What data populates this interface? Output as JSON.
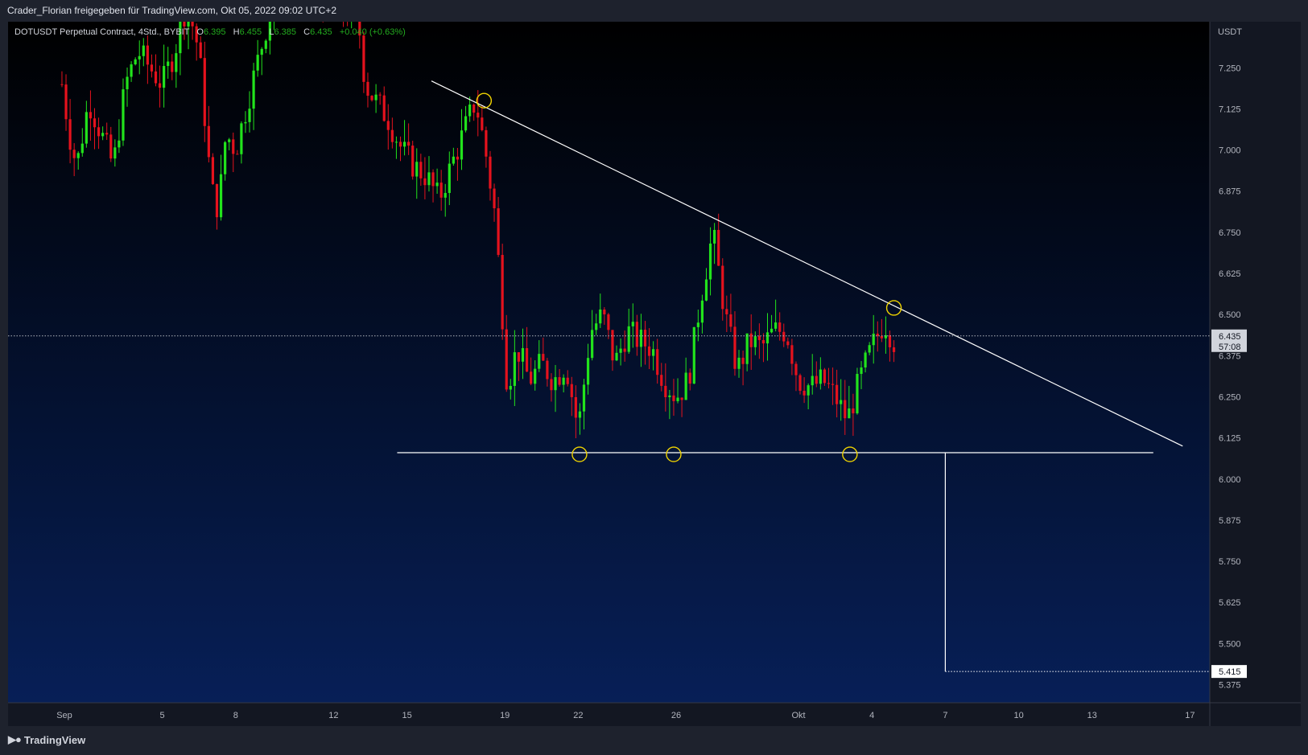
{
  "header": {
    "share_text": "Crader_Florian freigegeben für TradingView.com, Okt 05, 2022 09:02 UTC+2"
  },
  "legend": {
    "symbol": "DOTUSDT Perpetual Contract, 4Std., BYBIT",
    "open_label": "O",
    "open": "6.395",
    "high_label": "H",
    "high": "6.455",
    "low_label": "L",
    "low": "6.385",
    "close_label": "C",
    "close": "6.435",
    "change": "+0.040 (+0.63%)"
  },
  "footer": {
    "brand": "TradingView",
    "logo_icon": "tradingview-logo-icon"
  },
  "colors": {
    "up": "#22e31c",
    "down": "#e5121d",
    "bg_top": "#000000",
    "bg_bottom": "#071f57",
    "lines": "#ffffff",
    "marker": "#f0d400"
  },
  "chart_data": {
    "type": "candlestick",
    "currency_label": "USDT",
    "y_ticks": [
      "7.250",
      "7.125",
      "7.000",
      "6.875",
      "6.750",
      "6.625",
      "6.500",
      "6.375",
      "6.250",
      "6.125",
      "6.000",
      "5.875",
      "5.750",
      "5.625",
      "5.500",
      "5.375"
    ],
    "y_tick_values": [
      7.25,
      7.125,
      7.0,
      6.875,
      6.75,
      6.625,
      6.5,
      6.375,
      6.25,
      6.125,
      6.0,
      5.875,
      5.75,
      5.625,
      5.5,
      5.375
    ],
    "ylim": [
      5.32,
      7.39
    ],
    "x_ticks": [
      {
        "label": "Sep",
        "day": 1
      },
      {
        "label": "5",
        "day": 5
      },
      {
        "label": "8",
        "day": 8
      },
      {
        "label": "12",
        "day": 12
      },
      {
        "label": "15",
        "day": 15
      },
      {
        "label": "19",
        "day": 19
      },
      {
        "label": "22",
        "day": 22
      },
      {
        "label": "26",
        "day": 26
      },
      {
        "label": "Okt",
        "day": 31
      },
      {
        "label": "4",
        "day": 34
      },
      {
        "label": "7",
        "day": 37
      },
      {
        "label": "10",
        "day": 40
      },
      {
        "label": "13",
        "day": 43
      },
      {
        "label": "17",
        "day": 47
      }
    ],
    "last_price": {
      "value": 6.435,
      "label": "6.435",
      "countdown": "57:08"
    },
    "target_price": {
      "value": 5.415,
      "label": "5.415"
    },
    "price_path": [
      {
        "day": 0.9,
        "price": 7.2
      },
      {
        "day": 1.2,
        "price": 7.05
      },
      {
        "day": 1.5,
        "price": 6.95
      },
      {
        "day": 2.0,
        "price": 7.15
      },
      {
        "day": 2.5,
        "price": 7.05
      },
      {
        "day": 3.0,
        "price": 6.95
      },
      {
        "day": 3.5,
        "price": 7.2
      },
      {
        "day": 4.0,
        "price": 7.3
      },
      {
        "day": 4.5,
        "price": 7.25
      },
      {
        "day": 5.0,
        "price": 7.2
      },
      {
        "day": 5.5,
        "price": 7.3
      },
      {
        "day": 6.0,
        "price": 7.45
      },
      {
        "day": 6.5,
        "price": 7.3
      },
      {
        "day": 7.0,
        "price": 6.88
      },
      {
        "day": 7.3,
        "price": 6.82
      },
      {
        "day": 7.6,
        "price": 7.05
      },
      {
        "day": 8.0,
        "price": 7.0
      },
      {
        "day": 8.5,
        "price": 7.15
      },
      {
        "day": 9.0,
        "price": 7.3
      },
      {
        "day": 9.5,
        "price": 7.45
      },
      {
        "day": 10.0,
        "price": 7.5
      },
      {
        "day": 12.0,
        "price": 7.45
      },
      {
        "day": 13.0,
        "price": 7.4
      },
      {
        "day": 13.3,
        "price": 7.2
      },
      {
        "day": 13.7,
        "price": 7.15
      },
      {
        "day": 14.2,
        "price": 7.1
      },
      {
        "day": 14.8,
        "price": 7.0
      },
      {
        "day": 15.3,
        "price": 6.95
      },
      {
        "day": 15.8,
        "price": 6.92
      },
      {
        "day": 16.3,
        "price": 6.85
      },
      {
        "day": 16.8,
        "price": 6.95
      },
      {
        "day": 17.3,
        "price": 7.05
      },
      {
        "day": 17.8,
        "price": 7.15
      },
      {
        "day": 18.2,
        "price": 7.0
      },
      {
        "day": 18.6,
        "price": 6.8
      },
      {
        "day": 18.9,
        "price": 6.5
      },
      {
        "day": 19.1,
        "price": 6.28
      },
      {
        "day": 19.5,
        "price": 6.4
      },
      {
        "day": 20.0,
        "price": 6.3
      },
      {
        "day": 20.5,
        "price": 6.35
      },
      {
        "day": 21.0,
        "price": 6.3
      },
      {
        "day": 21.5,
        "price": 6.35
      },
      {
        "day": 22.0,
        "price": 6.15
      },
      {
        "day": 22.5,
        "price": 6.45
      },
      {
        "day": 23.0,
        "price": 6.5
      },
      {
        "day": 23.5,
        "price": 6.35
      },
      {
        "day": 24.0,
        "price": 6.45
      },
      {
        "day": 24.5,
        "price": 6.42
      },
      {
        "day": 25.0,
        "price": 6.4
      },
      {
        "day": 25.5,
        "price": 6.3
      },
      {
        "day": 26.0,
        "price": 6.25
      },
      {
        "day": 26.5,
        "price": 6.3
      },
      {
        "day": 27.0,
        "price": 6.55
      },
      {
        "day": 27.5,
        "price": 6.75
      },
      {
        "day": 28.0,
        "price": 6.5
      },
      {
        "day": 28.5,
        "price": 6.33
      },
      {
        "day": 29.0,
        "price": 6.42
      },
      {
        "day": 29.5,
        "price": 6.4
      },
      {
        "day": 30.0,
        "price": 6.45
      },
      {
        "day": 30.5,
        "price": 6.45
      },
      {
        "day": 31.0,
        "price": 6.3
      },
      {
        "day": 31.5,
        "price": 6.28
      },
      {
        "day": 32.0,
        "price": 6.3
      },
      {
        "day": 32.5,
        "price": 6.25
      },
      {
        "day": 33.0,
        "price": 6.18
      },
      {
        "day": 33.5,
        "price": 6.3
      },
      {
        "day": 34.0,
        "price": 6.4
      },
      {
        "day": 34.5,
        "price": 6.48
      },
      {
        "day": 34.9,
        "price": 6.42
      }
    ],
    "trendline": {
      "from": {
        "day": 16.0,
        "price": 7.21
      },
      "to": {
        "day": 46.7,
        "price": 6.1
      }
    },
    "support_line": {
      "from": {
        "day": 14.6,
        "price": 6.08
      },
      "to": {
        "day": 45.5,
        "price": 6.08
      }
    },
    "projection": {
      "day": 37.0,
      "from_price": 6.08,
      "to_price": 5.415
    },
    "markers": [
      {
        "day": 18.15,
        "price": 7.15
      },
      {
        "day": 22.05,
        "price": 6.075
      },
      {
        "day": 25.9,
        "price": 6.075
      },
      {
        "day": 33.1,
        "price": 6.075
      },
      {
        "day": 34.9,
        "price": 6.52
      }
    ]
  }
}
